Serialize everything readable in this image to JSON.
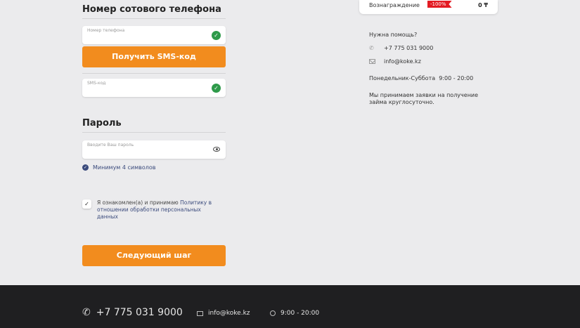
{
  "form": {
    "phone_section_title": "Номер сотового телефона",
    "phone_placeholder": "Номер телефона",
    "sms_button": "Получить SMS-код",
    "sms_placeholder": "SMS-код",
    "password_section_title": "Пароль",
    "password_placeholder": "Вводите Ваш пароль",
    "password_hint": "Минимум 4 символов",
    "agree_text": "Я ознакомлен(а) и принимаю ",
    "agree_link": "Политику в отношении обработки персональных данных",
    "next_button": "Следующий шаг"
  },
  "reward": {
    "label": "Вознаграждение",
    "badge": "-100%",
    "value": "0 ₸"
  },
  "help": {
    "title": "Нужна помощь?",
    "phone": "+7 775 031 9000",
    "email": "info@koke.kz",
    "hours": "Понедельник-Суббота  9:00 - 20:00",
    "note": "Мы принимаем заявки на получение займа круглосуточно."
  },
  "footer": {
    "phone": "+7 775 031 9000",
    "email": "info@koke.kz",
    "hours": "9:00 - 20:00"
  },
  "colors": {
    "accent": "#f28c1e",
    "check": "#2e9a4a",
    "link": "#3a4a7c",
    "badge": "#e31b23",
    "footer_bg": "#1f1f21"
  }
}
